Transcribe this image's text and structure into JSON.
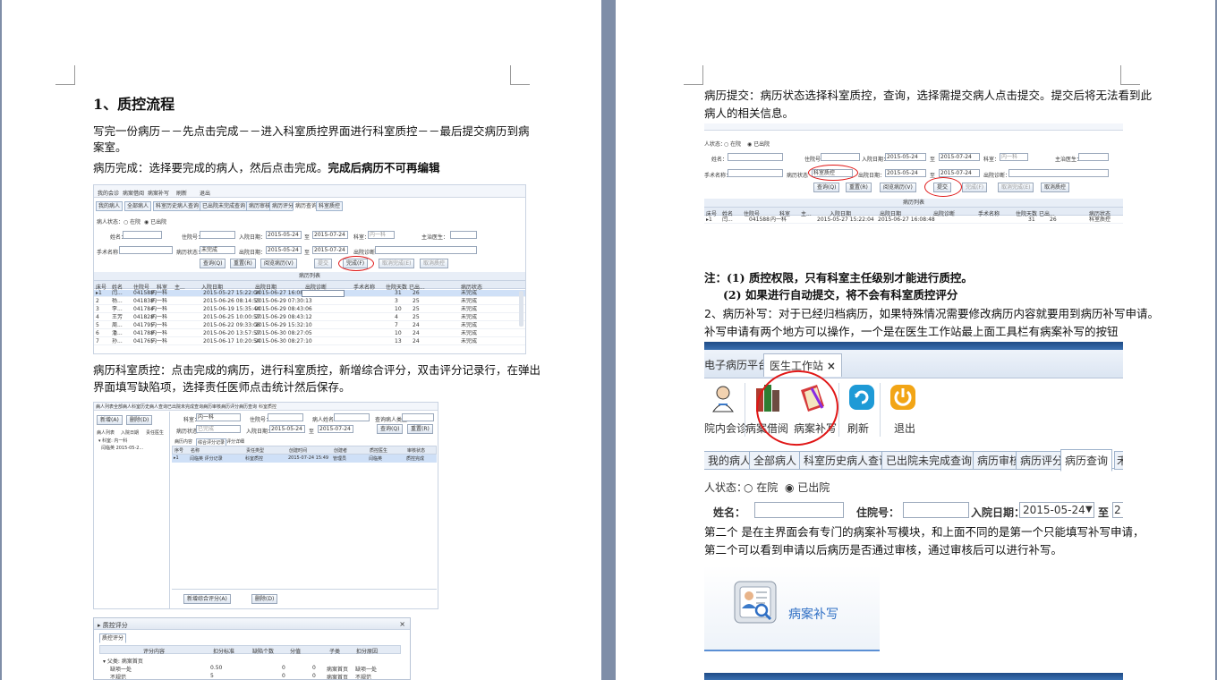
{
  "left_page": {
    "heading": "1、质控流程",
    "para1_line1": "写完一份病历－－先点击完成－－进入科室质控界面进行科室质控－－最后提交病历到病",
    "para1_line2": "案室。",
    "para2_normal": "病历完成：选择要完成的病人，然后点击完成。",
    "para2_bold": "完成后病历不可再编辑",
    "para3_line1": "病历科室质控：点击完成的病历，进行科室质控，新增综合评分，双击评分记录行，在弹出",
    "para3_line2": "界面填写缺陷项，选择责任医师点击统计然后保存。"
  },
  "ss1": {
    "menu": [
      "我的会诊",
      "病案借阅",
      "病案补写",
      "刷新",
      "退出"
    ],
    "tabs": [
      "我的病人",
      "全部病人",
      "科室历史病人查询",
      "已出院未完成查询",
      "病历审核",
      "病历评分",
      "病历查询",
      "科室质控"
    ],
    "patient_status_label": "病人状态：",
    "opt_in": "在院",
    "opt_out": "已出院",
    "name_label": "姓名：",
    "hosp_label": "住院号：",
    "admit_label": "入院日期：",
    "to": "至",
    "date1": "2015-05-24",
    "date2": "2015-07-24",
    "dept_label": "科室：",
    "dept_val": "内一科",
    "doctor_label": "主治医生：",
    "surgery_label": "手术名称：",
    "record_status_label": "病历状态：",
    "record_status_val": "未完成",
    "discharge_label": "出院日期：",
    "diag_label": "出院诊断：",
    "buttons": [
      "查询(Q)",
      "重置(R)",
      "阅览病历(V)",
      "提交",
      "完成(F)",
      "取消完成(E)",
      "取消质控"
    ],
    "list_title": "病历列表",
    "columns": [
      "床号",
      "姓名",
      "住院号",
      "科室",
      "主...",
      "入院日期",
      "出院日期",
      "出院诊断",
      "手术名称",
      "住院天数",
      "已出...",
      "病历状态"
    ],
    "rows": [
      [
        "▸1",
        "闫...",
        "041588",
        "内一科",
        "",
        "2015-05-27 15:22:04",
        "2015-06-27 16:08:48",
        "",
        "",
        "31",
        "26",
        "未完成"
      ],
      [
        "2",
        "杨...",
        "041838",
        "内一科",
        "",
        "2015-06-26 08:14:53",
        "2015-06-29 07:30:13",
        "",
        "",
        "3",
        "25",
        "未完成"
      ],
      [
        "3",
        "李...",
        "041784",
        "内一科",
        "",
        "2015-06-19 15:35:44",
        "2015-06-29 08:43:06",
        "",
        "",
        "10",
        "25",
        "未完成"
      ],
      [
        "4",
        "王芳",
        "041828",
        "内一科",
        "",
        "2015-06-25 10:00:57",
        "2015-06-29 08:43:12",
        "",
        "",
        "4",
        "25",
        "未完成"
      ],
      [
        "5",
        "周...",
        "041795",
        "内一科",
        "",
        "2015-06-22 09:33:08",
        "2015-06-29 15:32:10",
        "",
        "",
        "7",
        "24",
        "未完成"
      ],
      [
        "6",
        "潘...",
        "041788",
        "内一科",
        "",
        "2015-06-20 13:57:57",
        "2015-06-30 08:27:05",
        "",
        "",
        "10",
        "24",
        "未完成"
      ],
      [
        "7",
        "孙...",
        "041765",
        "内一科",
        "",
        "2015-06-17 10:20:54",
        "2015-06-30 08:27:10",
        "",
        "",
        "13",
        "24",
        "未完成"
      ]
    ]
  },
  "ss2": {
    "tabs": [
      "病人列表",
      "全部病人",
      "科室历史病人查询",
      "已出院未完成查询",
      "病历审核",
      "病历评分",
      "病历查询",
      "科室质控"
    ],
    "left_btns": [
      "新增(A)",
      "删除(D)"
    ],
    "left_tabs": [
      "病人列表",
      "入院日期",
      "责任医生"
    ],
    "tree_root": "▾ 科室: 内一科",
    "tree_item": "闫临英    2015-05-2...",
    "dept_label": "科室：",
    "dept_val": "内一科",
    "hosp_label": "住院号：",
    "name_label": "病人姓名：",
    "type_label": "查询病人类型：",
    "status_label": "病历状态：",
    "status_val": "已完成",
    "admit_label": "入院日期：",
    "date1": "2015-05-24",
    "to": "至",
    "date2": "2015-07-24",
    "query_btn": "查询(Q)",
    "reset_btn": "重置(R)",
    "sub_tabs": [
      "病历内容",
      "综合评分记录",
      "评分详细"
    ],
    "grid_cols": [
      "序号",
      "名称",
      "责任类型",
      "创建时间",
      "创建者",
      "质控医生",
      "审核状态"
    ],
    "grid_row": [
      "▸1",
      "闫临英 评分记录",
      "科室质控",
      "2015-07-24 15:49",
      "管理员",
      "闫临英",
      "质控完成"
    ],
    "bottom_btns": [
      "新增综合评分(A)",
      "删除(D)"
    ]
  },
  "ss3": {
    "title": "质控评分",
    "close": "×",
    "tab": "质控评分",
    "cols": [
      "评分内容",
      "扣分标准",
      "缺陷个数",
      "分值",
      "子类",
      "扣分原因"
    ],
    "group": "▾ 父类: 病案首页",
    "rows": [
      [
        "缺项一处",
        "0.50",
        "0",
        "0",
        "病案首页",
        "缺项一处"
      ],
      [
        "不规范",
        "5",
        "0",
        "0",
        "病案首页",
        "不规范"
      ]
    ]
  },
  "right_page": {
    "para1_line1": "病历提交：病历状态选择科室质控，查询，选择需提交病人点击提交。提交后将无法看到此",
    "para1_line2": "病人的相关信息。",
    "note1": "注：(1) 质控权限，只有科室主任级别才能进行质控。",
    "note2": "(2) 如果进行自动提交，将不会有科室质控评分",
    "para2_line1": "2、病历补写：对于已经归档病历，如果特殊情况需要修改病历内容就要用到病历补写申请。",
    "para2_line2": "补写申请有两个地方可以操作，一个是在医生工作站最上面工具栏有病案补写的按钮",
    "para3_line1": "第二个 是在主界面会有专门的病案补写模块，和上面不同的是第一个只能填写补写申请，",
    "para3_line2": "第二个可以看到申请以后病历是否通过审核，通过审核后可以进行补写。"
  },
  "ss4": {
    "status_label": "人状态：",
    "opt_in": "在院",
    "opt_out": "已出院",
    "name_label": "姓名：",
    "hosp_label": "住院号：",
    "admit_label": "入院日期：",
    "date1": "2015-05-24",
    "to": "至",
    "date2": "2015-07-24",
    "dept_label": "科室：",
    "dept_val": "内一科",
    "doctor_label": "主治医生：",
    "surgery_label": "手术名称：",
    "record_status_label": "病历状态",
    "record_status_val": "科室质控",
    "discharge_label": "出院日期：",
    "diag_label": "出院诊断：",
    "buttons": [
      "查询(Q)",
      "重置(R)",
      "阅览病历(V)",
      "提交",
      "完成(F)",
      "取消完成(E)",
      "取消质控"
    ],
    "list_title": "病历列表",
    "columns": [
      "床号",
      "姓名",
      "住院号",
      "科室",
      "主...",
      "入院日期",
      "出院日期",
      "出院诊断",
      "手术名称",
      "住院天数",
      "已出...",
      "病历状态"
    ],
    "row": [
      "▸1",
      "闫...",
      "041588",
      "内一科",
      "",
      "2015-05-27 15:22:04",
      "2015-06-27 16:08:48",
      "",
      "",
      "31",
      "26",
      "科室质控"
    ]
  },
  "ss5": {
    "top_tabs": [
      "电子病历平台",
      "医生工作站"
    ],
    "close": "×",
    "icons": [
      "院内会诊",
      "病案借阅",
      "病案补写",
      "刷新",
      "退出"
    ],
    "tabs": [
      "我的病人",
      "全部病人",
      "科室历史病人查询",
      "已出院未完成查询",
      "病历审核",
      "病历评分",
      "病历查询"
    ],
    "status_label": "人状态：",
    "opt_in": "在院",
    "opt_out": "已出院",
    "name_label": "姓名：",
    "hosp_label": "住院号：",
    "admit_label": "入院日期：",
    "date1": "2015-05-24",
    "to": "至"
  },
  "ss6": {
    "label": "病案补写"
  },
  "colors": {
    "accent_red": "#e01616",
    "ui_blue": "#2f6fc4"
  }
}
